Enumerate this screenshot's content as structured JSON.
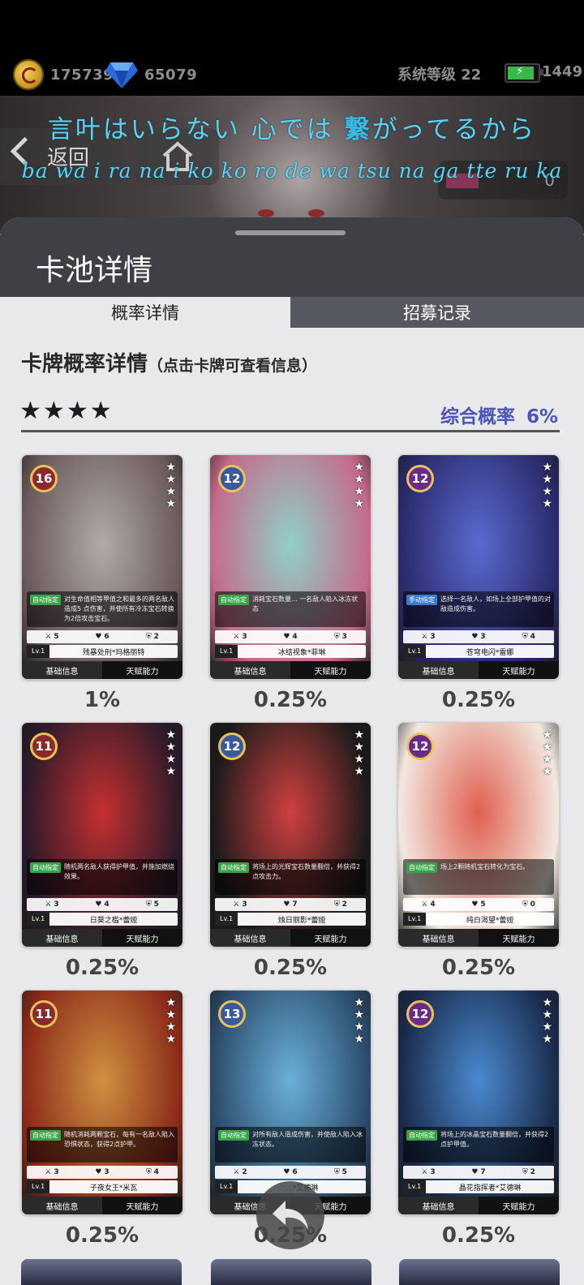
{
  "statusbar": {
    "coins": "175739",
    "gems": "65079",
    "system_level": "系统等级 22",
    "battery_value": "1449"
  },
  "banner": {
    "back_label": "返回",
    "right_count": "0",
    "lyric_line1_a": "言叶はいらない 心では ",
    "lyric_line1_b": "繋",
    "lyric_line1_c": "がってるから",
    "lyric_line2": "ba wa i ra na i ko ko ro de wa tsu na ga tte ru ka"
  },
  "panel": {
    "title": "卡池详情",
    "tabs": [
      {
        "label": "概率详情",
        "active": true
      },
      {
        "label": "招募记录",
        "active": false
      }
    ],
    "section_title": "卡牌概率详情",
    "section_hint": "（点击卡牌可查看信息）",
    "star_row": [
      "★",
      "★",
      "★",
      "★"
    ],
    "rate_label": "综合概率",
    "rate_value": "6%"
  },
  "card_common": {
    "lv_label": "Lv.1",
    "btn_info": "基础信息",
    "btn_talent": "天赋能力"
  },
  "cards": [
    {
      "level": "16",
      "tag": "自动指定",
      "skill": "对生命值相等甲值之和最多的两名敌人造成5 点伤害，并使所有冷冻宝石转换为2倍攻击宝石。",
      "atk": "5",
      "hp": "6",
      "def": "2",
      "name": "残暴处刑*玛格丽特",
      "prob": "1%",
      "color": "#b0aaa8",
      "accent": "#6a5a5a"
    },
    {
      "level": "12",
      "tag": "自动指定",
      "skill": "消耗宝石数量... 一名敌人陷入冰冻状态",
      "atk": "3",
      "hp": "4",
      "def": "3",
      "name": "冰结视象*菲琳",
      "prob": "0.25%",
      "color": "#8fd0c8",
      "accent": "#c46a8a"
    },
    {
      "level": "12",
      "tag": "手动指定",
      "skill": "选择一名敌人，如场上全部护甲值的对敌造成伤害。",
      "atk": "3",
      "hp": "3",
      "def": "4",
      "name": "苍穹电闪*雷娜",
      "prob": "0.25%",
      "color": "#5a6ad0",
      "accent": "#2a2a6a"
    },
    {
      "level": "11",
      "tag": "自动指定",
      "skill": "随机两名敌人获得护甲值，并施加燃烧效果。",
      "atk": "3",
      "hp": "4",
      "def": "5",
      "name": "日葵之槛*蕾娅",
      "prob": "0.25%",
      "color": "#c43030",
      "accent": "#2a1a2a"
    },
    {
      "level": "12",
      "tag": "自动指定",
      "skill": "将场上的光辉宝石数量翻倍，并获得2点攻击力。",
      "atk": "3",
      "hp": "7",
      "def": "2",
      "name": "烛日丽影*蕾娅",
      "prob": "0.25%",
      "color": "#d04040",
      "accent": "#1a1a1a"
    },
    {
      "level": "12",
      "tag": "自动指定",
      "skill": "场上2颗随机宝石转化为宝石。",
      "atk": "4",
      "hp": "5",
      "def": "0",
      "name": "纯白渴望*蕾娅",
      "prob": "0.25%",
      "color": "#e06050",
      "accent": "#f2e8e0"
    },
    {
      "level": "11",
      "tag": "自动指定",
      "skill": "随机消耗两颗宝石，每有一名敌人陷入恐惧状态，获得2点护甲。",
      "atk": "3",
      "hp": "3",
      "def": "4",
      "name": "子夜女王*米瓦",
      "prob": "0.25%",
      "color": "#d09040",
      "accent": "#8a2a1a"
    },
    {
      "level": "13",
      "tag": "自动指定",
      "skill": "对所有敌人造成伤害，并使敌人陷入冰冻状态。",
      "atk": "2",
      "hp": "6",
      "def": "5",
      "name": "…*艾德琳",
      "prob": "0.25%",
      "color": "#6ab0d8",
      "accent": "#2a4a6a"
    },
    {
      "level": "12",
      "tag": "自动指定",
      "skill": "将场上的冰晶宝石数量翻倍，并获得2点护甲值。",
      "atk": "3",
      "hp": "7",
      "def": "2",
      "name": "晶花指挥者*艾德琳",
      "prob": "0.25%",
      "color": "#4a8ad0",
      "accent": "#1a2a4a"
    }
  ]
}
